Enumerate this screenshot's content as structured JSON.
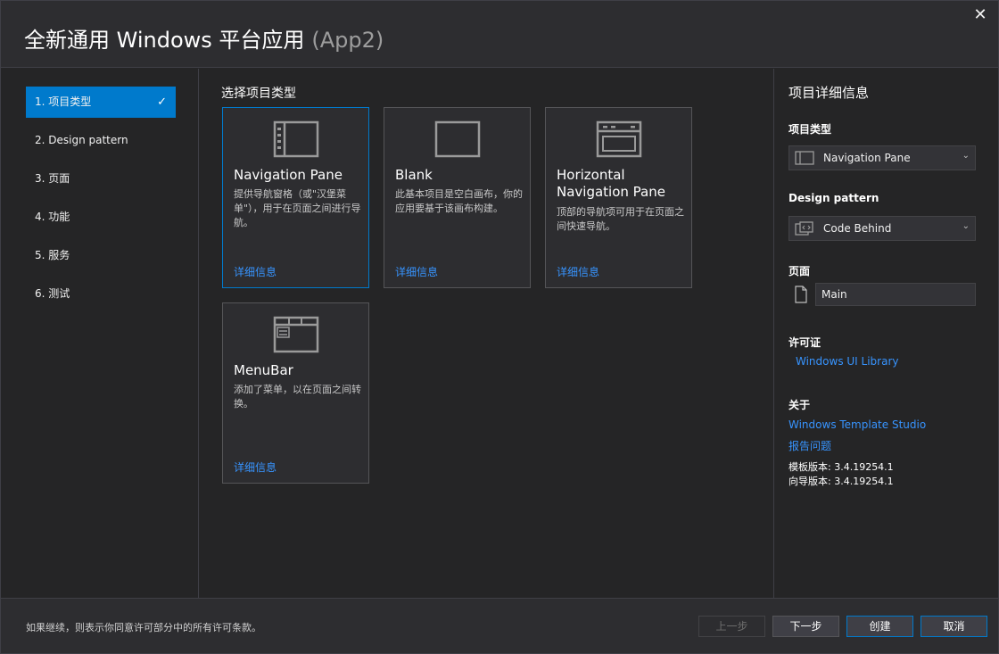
{
  "window": {
    "title": "全新通用 Windows 平台应用",
    "subtitle": "(App2)",
    "close_icon": "✕"
  },
  "steps": [
    {
      "label": "1. 项目类型",
      "active": true
    },
    {
      "label": "2. Design pattern",
      "active": false
    },
    {
      "label": "3. 页面",
      "active": false
    },
    {
      "label": "4. 功能",
      "active": false
    },
    {
      "label": "5. 服务",
      "active": false
    },
    {
      "label": "6. 测试",
      "active": false
    }
  ],
  "step_check": "✓",
  "center": {
    "section_title": "选择项目类型",
    "cards": [
      {
        "title": "Navigation Pane",
        "desc": "提供导航窗格（或\"汉堡菜单\"），用于在页面之间进行导航。",
        "link": "详细信息",
        "icon": "navigation-pane-icon"
      },
      {
        "title": "Blank",
        "desc": "此基本项目是空白画布，你的应用要基于该画布构建。",
        "link": "详细信息",
        "icon": "blank-icon"
      },
      {
        "title": "Horizontal Navigation Pane",
        "desc": "顶部的导航项可用于在页面之间快速导航。",
        "link": "详细信息",
        "icon": "horizontal-navigation-icon"
      },
      {
        "title": "MenuBar",
        "desc": "添加了菜单，以在页面之间转换。",
        "link": "详细信息",
        "icon": "menubar-icon"
      }
    ]
  },
  "details": {
    "title": "项目详细信息",
    "project_type_label": "项目类型",
    "project_type_value": "Navigation Pane",
    "design_pattern_label": "Design pattern",
    "design_pattern_value": "Code Behind",
    "page_label": "页面",
    "page_value": "Main",
    "license_label": "许可证",
    "license_link": "Windows UI Library",
    "about_label": "关于",
    "about_link": "Windows Template Studio",
    "report_link": "报告问题",
    "template_version": "模板版本: 3.4.19254.1",
    "wizard_version": "向导版本: 3.4.19254.1"
  },
  "footer": {
    "notice": "如果继续，则表示你同意许可部分中的所有许可条款。",
    "prev": "上一步",
    "next": "下一步",
    "create": "创建",
    "cancel": "取消"
  },
  "colors": {
    "accent": "#007acc",
    "link": "#3794ff",
    "background": "#252526"
  }
}
